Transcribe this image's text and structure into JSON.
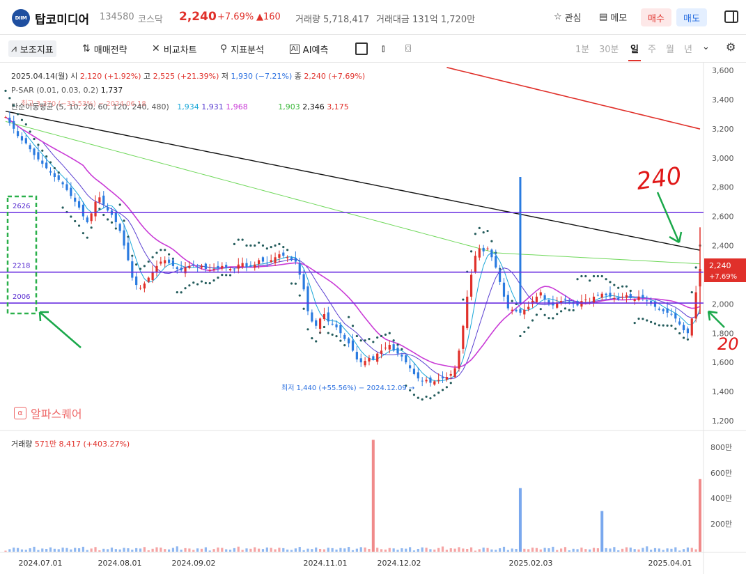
{
  "header": {
    "logo_text": "DIIM",
    "name": "탑코미디어",
    "code": "134580",
    "market": "코스닥",
    "price": "2,240",
    "change_pct": "+7.69%",
    "change": "▲160",
    "volume": "거래량 5,718,417",
    "amount": "거래대금 131억 1,720만",
    "fav": "관심",
    "memo": "메모",
    "buy": "매수",
    "sell": "매도"
  },
  "toolbar": {
    "indicators": "보조지표",
    "strategy": "매매전략",
    "compare": "비교차트",
    "analysis": "지표분석",
    "ai": "AI예측",
    "periods": [
      "1분",
      "30분",
      "일",
      "주",
      "월",
      "년"
    ],
    "active_period": "일"
  },
  "legend": {
    "date_line": "2025.04.14(월)",
    "open_label": "시",
    "open": "2,120 (+1.92%)",
    "high_label": "고",
    "high": "2,525 (+21.39%)",
    "low_label": "저",
    "low": "1,930 (−7.21%)",
    "close_label": "종",
    "close": "2,240 (+7.69%)",
    "psar": "P-SAR",
    "psar_params": "(0.01, 0.03, 0.2)",
    "psar_value": "1,737",
    "ma_label": "단순이동평균",
    "ma_params": "(5, 10, 20, 60, 120, 240, 480)",
    "ma_values": [
      "1,934",
      "1,931",
      "1,968",
      "1,903",
      "2,346",
      "3,175"
    ],
    "high_note": "최고 3,370 (−33.53%) − 2024.06.18"
  },
  "brand": "알파스퀘어",
  "volume_legend": {
    "label": "거래량",
    "value": "571만 8,417 (+403.27%)"
  },
  "annotations": {
    "low_note": "최저 1,440 (+55.56%) − 2024.12.09",
    "hw_top": "240",
    "hw_bottom": "20",
    "level_2626": "2626",
    "level_2218": "2218",
    "level_2006": "2006",
    "last_price": "2,240",
    "last_pct": "+7.69%"
  },
  "chart_data": {
    "type": "candlestick",
    "y_ticks": [
      "3,600",
      "3,400",
      "3,200",
      "3,000",
      "2,800",
      "2,600",
      "2,400",
      "2,200",
      "2,000",
      "1,800",
      "1,600",
      "1,400",
      "1,200"
    ],
    "ylim": [
      1200,
      3600
    ],
    "vol_ticks": [
      "800만",
      "600만",
      "400만",
      "200만"
    ],
    "x_ticks": [
      "2024.07.01",
      "2024.08.01",
      "2024.09.02",
      "2024.11.01",
      "2024.12.02",
      "2025.02.03",
      "2025.04.01"
    ],
    "horizontal_lines": [
      2626,
      2218,
      2006
    ],
    "close_series": [
      3280,
      3240,
      3200,
      3150,
      3120,
      3100,
      3060,
      3020,
      2990,
      2960,
      2930,
      2900,
      2870,
      2850,
      2820,
      2780,
      2740,
      2700,
      2660,
      2600,
      2560,
      2620,
      2700,
      2730,
      2680,
      2640,
      2610,
      2560,
      2500,
      2400,
      2300,
      2180,
      2130,
      2110,
      2140,
      2180,
      2220,
      2260,
      2290,
      2300,
      2280,
      2260,
      2240,
      2230,
      2250,
      2260,
      2270,
      2250,
      2260,
      2240,
      2230,
      2240,
      2250,
      2260,
      2250,
      2240,
      2230,
      2270,
      2280,
      2250,
      2260,
      2270,
      2300,
      2290,
      2280,
      2300,
      2320,
      2340,
      2330,
      2320,
      2300,
      2290,
      2200,
      2100,
      1950,
      1880,
      1850,
      1900,
      1930,
      1880,
      1860,
      1840,
      1800,
      1760,
      1730,
      1680,
      1620,
      1600,
      1610,
      1630,
      1620,
      1660,
      1680,
      1700,
      1720,
      1680,
      1660,
      1640,
      1600,
      1560,
      1520,
      1490,
      1470,
      1480,
      1460,
      1470,
      1480,
      1490,
      1500,
      1520,
      1560,
      1680,
      1850,
      2050,
      2200,
      2330,
      2380,
      2360,
      2380,
      2320,
      2250,
      2150,
      2050,
      1970,
      1960,
      1950,
      1940,
      1960,
      1980,
      2020,
      2050,
      2080,
      2030,
      2000,
      1990,
      2010,
      2020,
      2030,
      2010,
      2000,
      1990,
      2020,
      2030,
      2010,
      2050,
      2060,
      2070,
      2060,
      2050,
      2040,
      2030,
      2050,
      2060,
      2040,
      2030,
      2050,
      2040,
      2020,
      2000,
      1980,
      1960,
      1950,
      1940,
      1930,
      1900,
      1860,
      1820,
      1800,
      1900,
      2080,
      2240
    ],
    "volume_spikes": [
      {
        "date": "2024.10.28",
        "value": 880
      },
      {
        "date": "2025.01.31",
        "value": 500
      },
      {
        "date": "2025.02.21",
        "value": 320
      },
      {
        "date": "2025.04.14",
        "value": 571
      }
    ]
  }
}
